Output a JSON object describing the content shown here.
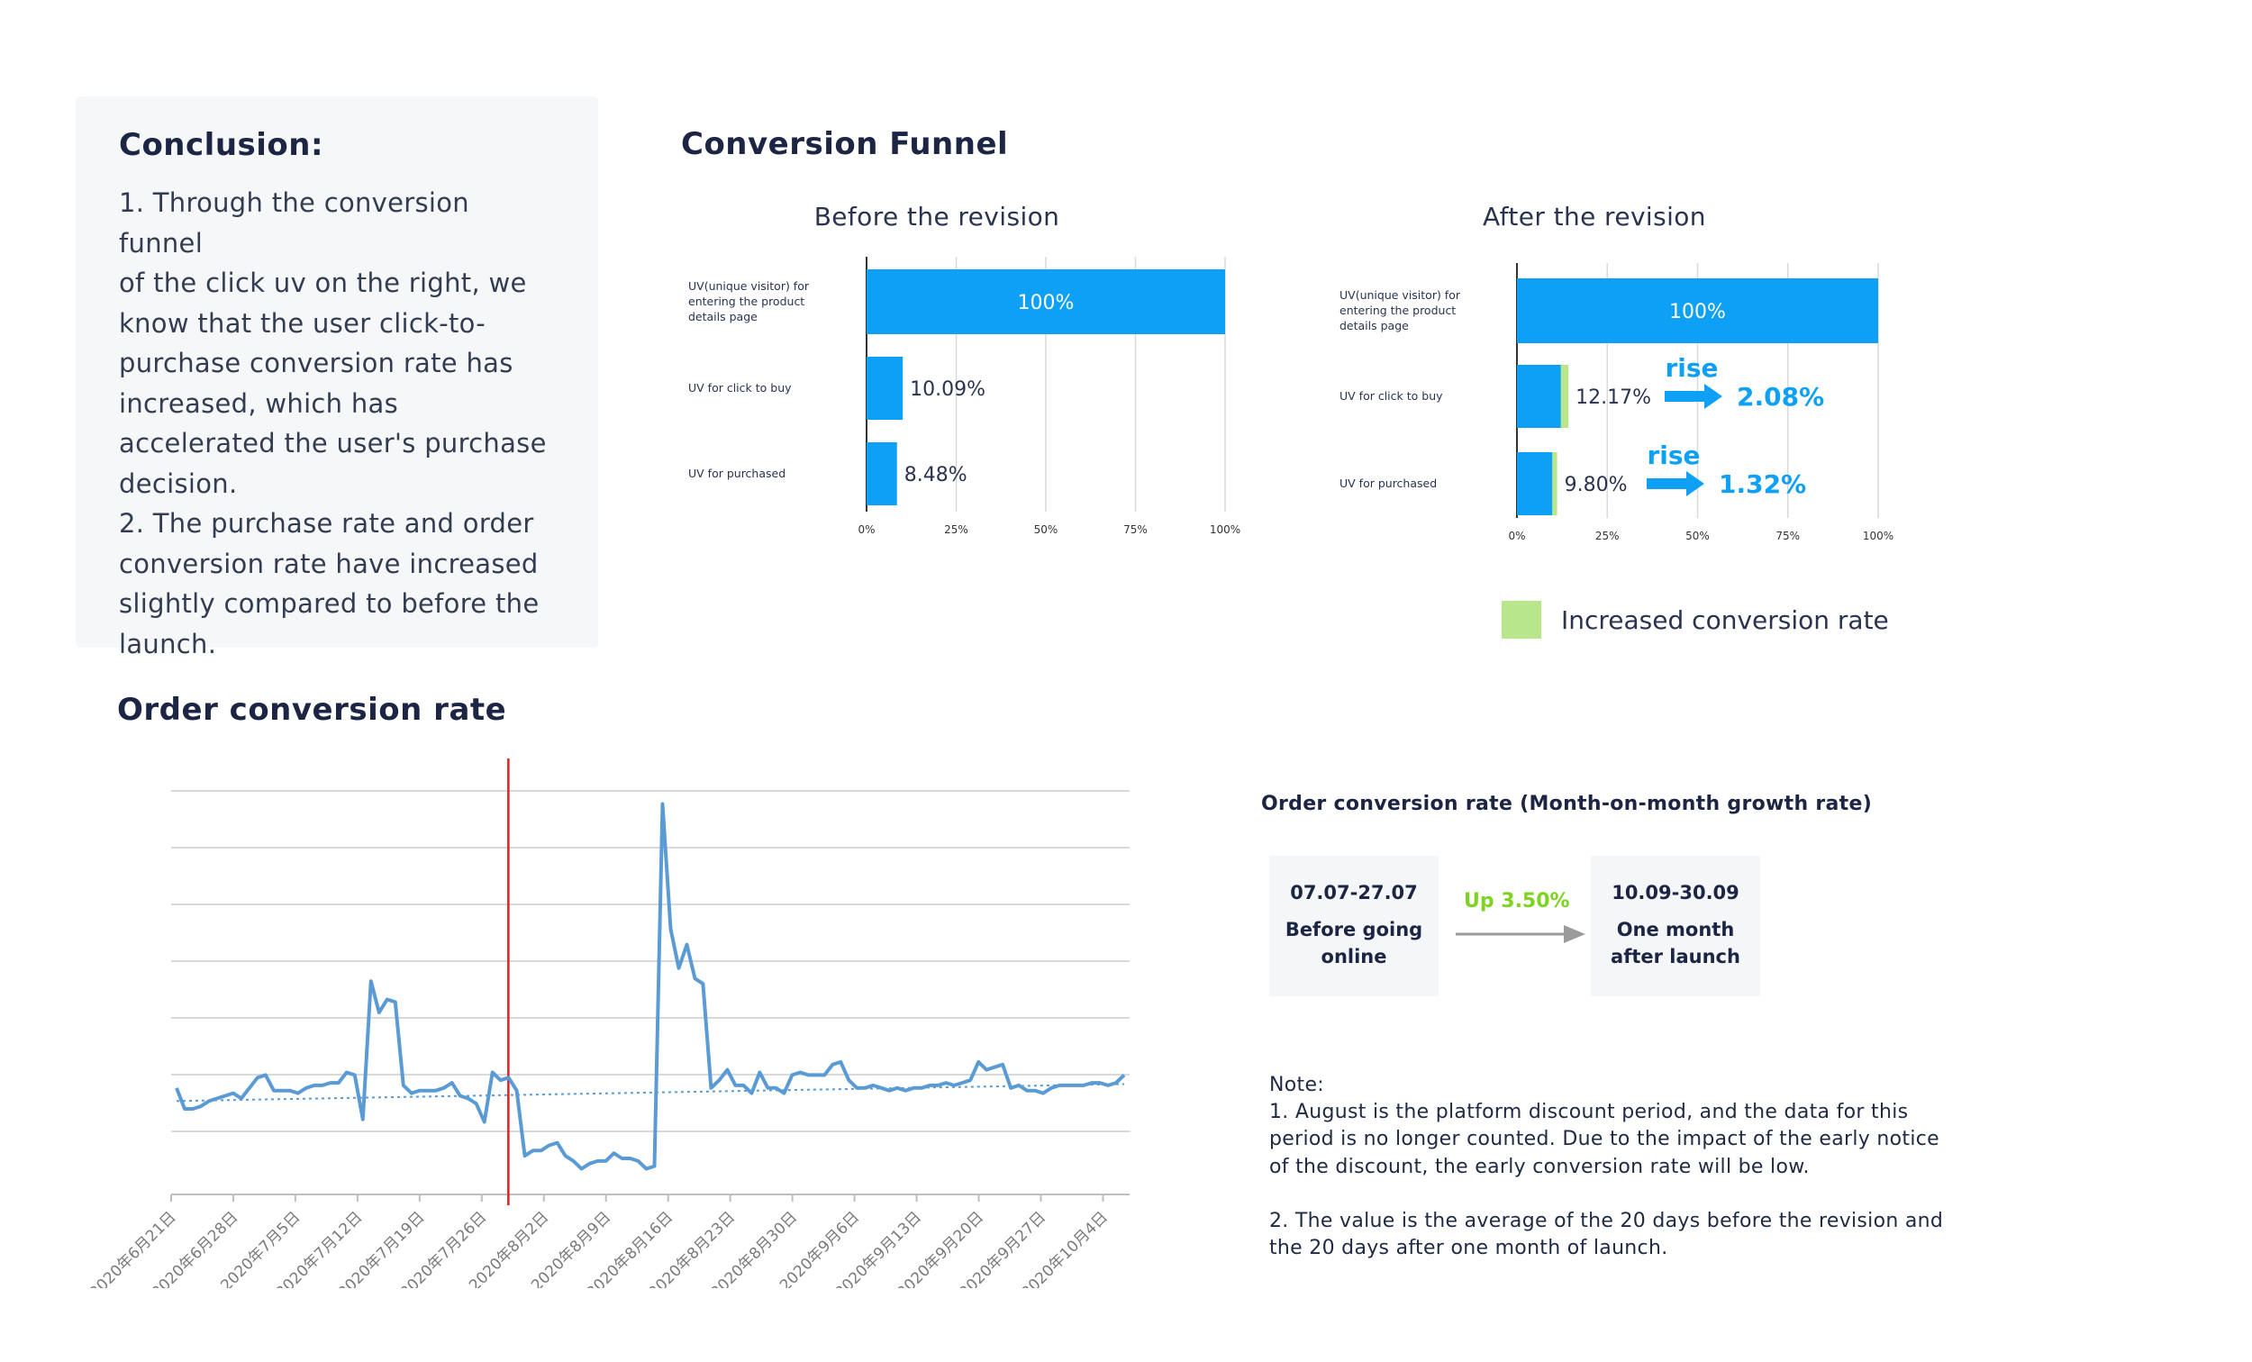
{
  "conclusion": {
    "title": "Conclusion:",
    "lines": [
      "1. Through the conversion funnel",
      "of the click uv on the right, we",
      "know that the user click-to-",
      "purchase conversion rate has",
      "increased, which has",
      "accelerated the user's purchase",
      "decision.",
      "2. The purchase rate and order",
      "conversion rate have increased",
      "slightly compared to before the",
      "launch."
    ]
  },
  "funnel": {
    "title": "Conversion Funnel",
    "before_title": "Before the revision",
    "after_title": "After the revision",
    "legend_label": "Increased conversion rate",
    "rise_label": "rise",
    "colors": {
      "bar": "#0ea0f5",
      "increase": "#b8e68a",
      "grid": "#d9d9d9"
    }
  },
  "line_section": {
    "title": "Order conversion rate"
  },
  "growth": {
    "title": "Order conversion rate (Month-on-month growth rate)",
    "before": {
      "date": "07.07-27.07",
      "label_1": "Before going",
      "label_2": "online"
    },
    "after": {
      "date": "10.09-30.09",
      "label_1": "One month",
      "label_2": "after launch"
    },
    "change": "Up 3.50%"
  },
  "note": {
    "heading": "Note:",
    "p1": "1. August is the platform discount period, and the data for this\nperiod is no longer counted. Due to the impact of the early notice\nof the discount, the early conversion rate will be low.",
    "p2": "2. The value is the average of the 20 days before the revision and\nthe 20 days after one month of launch."
  },
  "chart_data": [
    {
      "type": "bar",
      "title": "Before the revision",
      "categories": [
        "UV(unique visitor) for entering the product details page",
        "UV for click to buy",
        "UV for purchased"
      ],
      "values": [
        100,
        10.09,
        8.48
      ],
      "value_labels": [
        "100%",
        "10.09%",
        "8.48%"
      ],
      "x_ticks": [
        "0%",
        "25%",
        "50%",
        "75%",
        "100%"
      ],
      "xlim": [
        0,
        100
      ]
    },
    {
      "type": "bar",
      "title": "After the revision",
      "categories": [
        "UV(unique visitor) for entering the product details page",
        "UV for click to buy",
        "UV for purchased"
      ],
      "series": [
        {
          "name": "base",
          "values": [
            100,
            12.17,
            9.8
          ]
        },
        {
          "name": "Increased conversion rate",
          "values": [
            0,
            2.08,
            1.32
          ]
        }
      ],
      "value_labels": [
        "100%",
        "12.17%",
        "9.80%"
      ],
      "rise_labels": [
        "",
        "2.08%",
        "1.32%"
      ],
      "x_ticks": [
        "0%",
        "25%",
        "50%",
        "75%",
        "100%"
      ],
      "xlim": [
        0,
        100
      ]
    },
    {
      "type": "line",
      "title": "Order conversion rate",
      "x_tick_labels": [
        "2020年6月21日",
        "2020年6月28日",
        "2020年7月5日",
        "2020年7月12日",
        "2020年7月19日",
        "2020年7月26日",
        "2020年8月2日",
        "2020年8月9日",
        "2020年8月16日",
        "2020年8月23日",
        "2020年8月30日",
        "2020年9月6日",
        "2020年9月13日",
        "2020年9月20日",
        "2020年9月27日",
        "2020年10月4日"
      ],
      "x_start": "2020-06-21",
      "x_end": "2020-10-07",
      "y_gridlines": 7,
      "event_marker_date": "2020-07-29",
      "trendline": {
        "start": 0.31,
        "end": 0.375
      },
      "values": [
        0.36,
        0.28,
        0.28,
        0.29,
        0.31,
        0.32,
        0.33,
        0.34,
        0.32,
        0.36,
        0.4,
        0.41,
        0.35,
        0.35,
        0.35,
        0.34,
        0.36,
        0.37,
        0.37,
        0.38,
        0.38,
        0.42,
        0.41,
        0.24,
        0.77,
        0.65,
        0.7,
        0.69,
        0.37,
        0.34,
        0.35,
        0.35,
        0.35,
        0.36,
        0.38,
        0.33,
        0.32,
        0.3,
        0.23,
        0.42,
        0.39,
        0.4,
        0.35,
        0.1,
        0.12,
        0.12,
        0.14,
        0.15,
        0.1,
        0.08,
        0.05,
        0.07,
        0.08,
        0.08,
        0.11,
        0.09,
        0.09,
        0.08,
        0.05,
        0.06,
        1.45,
        0.97,
        0.82,
        0.91,
        0.78,
        0.76,
        0.36,
        0.39,
        0.43,
        0.37,
        0.37,
        0.34,
        0.42,
        0.36,
        0.36,
        0.34,
        0.41,
        0.42,
        0.41,
        0.41,
        0.41,
        0.45,
        0.46,
        0.39,
        0.36,
        0.36,
        0.37,
        0.36,
        0.35,
        0.36,
        0.35,
        0.36,
        0.36,
        0.37,
        0.37,
        0.38,
        0.37,
        0.38,
        0.39,
        0.46,
        0.43,
        0.44,
        0.45,
        0.36,
        0.37,
        0.35,
        0.35,
        0.34,
        0.36,
        0.37,
        0.37,
        0.37,
        0.37,
        0.38,
        0.38,
        0.37,
        0.38,
        0.41
      ]
    }
  ]
}
